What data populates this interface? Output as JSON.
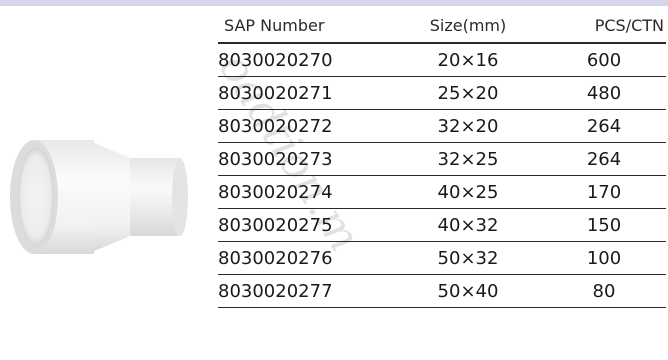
{
  "watermark": "oadtion.m",
  "table": {
    "headers": [
      "SAP Number",
      "Size(mm)",
      "PCS/CTN"
    ],
    "rows": [
      [
        "8030020270",
        "20×16",
        "600"
      ],
      [
        "8030020271",
        "25×20",
        "480"
      ],
      [
        "8030020272",
        "32×20",
        "264"
      ],
      [
        "8030020273",
        "32×25",
        "264"
      ],
      [
        "8030020274",
        "40×25",
        "170"
      ],
      [
        "8030020275",
        "40×32",
        "150"
      ],
      [
        "8030020276",
        "50×32",
        "100"
      ],
      [
        "8030020277",
        "50×40",
        "80"
      ]
    ]
  },
  "colors": {
    "band": "#d6d6ea",
    "rule": "#2a2a2a",
    "text": "#1a1a1a"
  }
}
